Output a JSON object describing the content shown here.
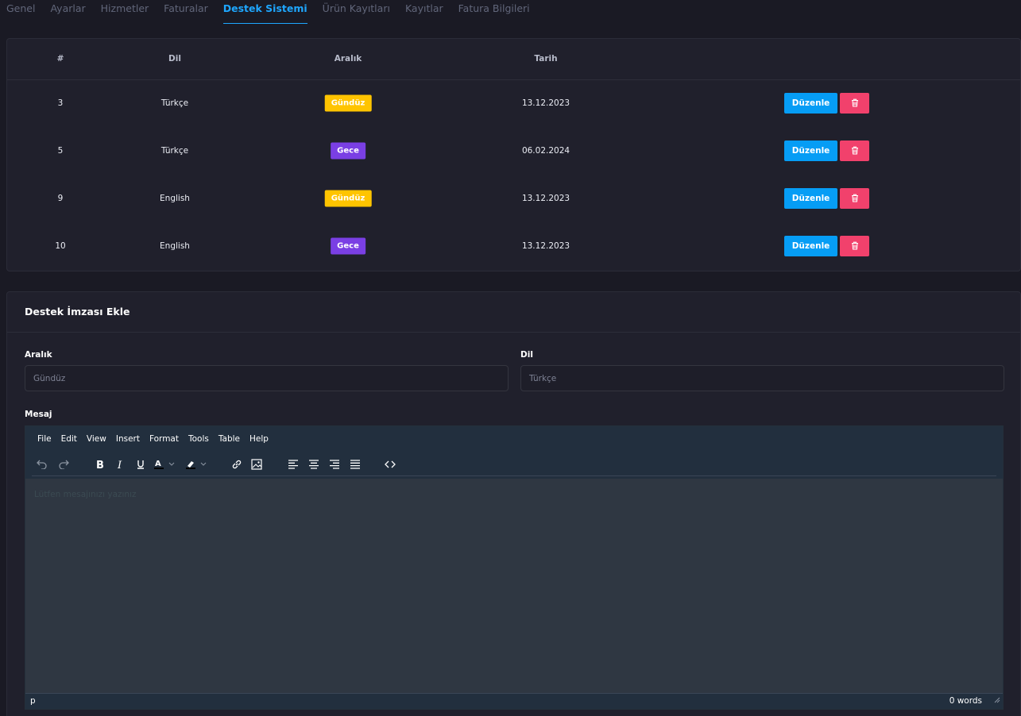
{
  "tabs": [
    {
      "label": "Genel",
      "active": false
    },
    {
      "label": "Ayarlar",
      "active": false
    },
    {
      "label": "Hizmetler",
      "active": false
    },
    {
      "label": "Faturalar",
      "active": false
    },
    {
      "label": "Destek Sistemi",
      "active": true
    },
    {
      "label": "Ürün Kayıtları",
      "active": false
    },
    {
      "label": "Kayıtlar",
      "active": false
    },
    {
      "label": "Fatura Bilgileri",
      "active": false
    }
  ],
  "table": {
    "headers": {
      "id": "#",
      "lang": "Dil",
      "range": "Aralık",
      "date": "Tarih"
    },
    "edit_label": "Düzenle",
    "rows": [
      {
        "id": "3",
        "lang": "Türkçe",
        "range": "Gündüz",
        "range_type": "gunduz",
        "date": "13.12.2023"
      },
      {
        "id": "5",
        "lang": "Türkçe",
        "range": "Gece",
        "range_type": "gece",
        "date": "06.02.2024"
      },
      {
        "id": "9",
        "lang": "English",
        "range": "Gündüz",
        "range_type": "gunduz",
        "date": "13.12.2023"
      },
      {
        "id": "10",
        "lang": "English",
        "range": "Gece",
        "range_type": "gece",
        "date": "13.12.2023"
      }
    ]
  },
  "form": {
    "title": "Destek İmzası Ekle",
    "range_label": "Aralık",
    "range_value": "Gündüz",
    "lang_label": "Dil",
    "lang_value": "Türkçe",
    "message_label": "Mesaj"
  },
  "editor": {
    "menu": [
      "File",
      "Edit",
      "View",
      "Insert",
      "Format",
      "Tools",
      "Table",
      "Help"
    ],
    "placeholder": "Lütfen mesajınızı yazınız",
    "status_path": "p",
    "word_count": "0 words"
  },
  "colors": {
    "accent": "#1ea7ff",
    "edit_button": "#069df5",
    "delete_button": "#f1416c",
    "badge_gunduz": "#ffc400",
    "badge_gece": "#7a3fe4"
  }
}
